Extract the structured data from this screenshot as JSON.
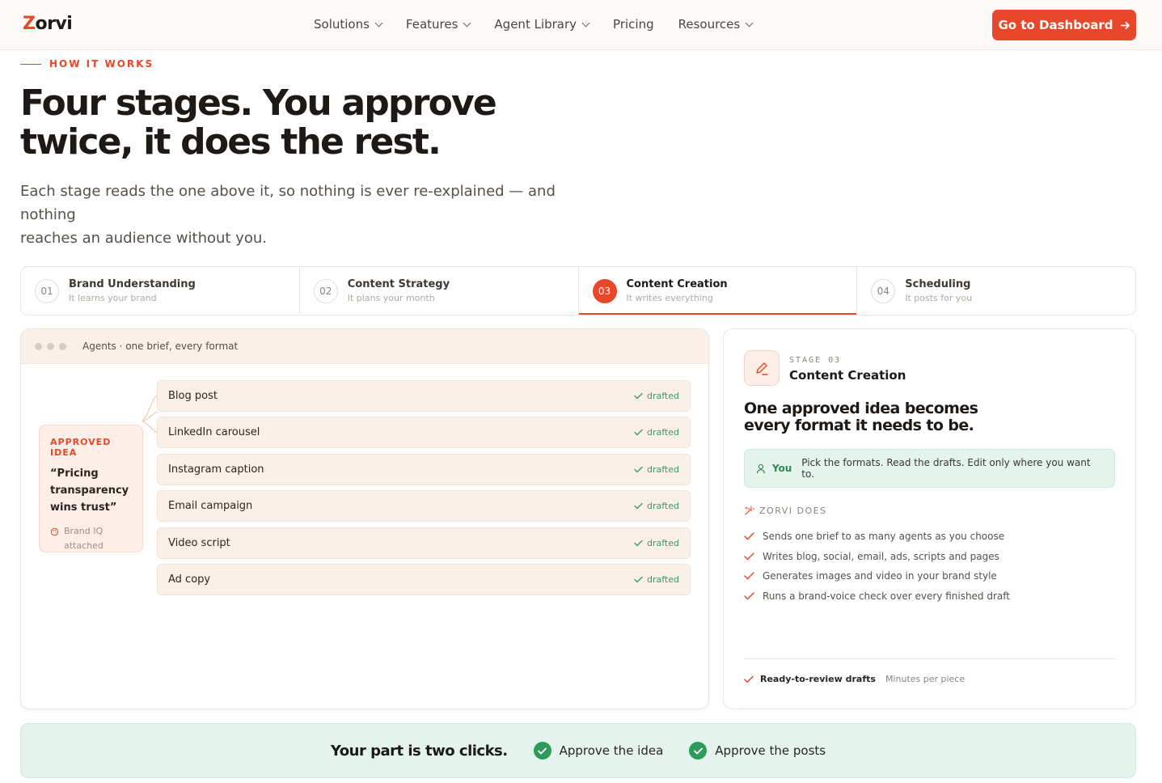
{
  "nav": {
    "logo_first": "Z",
    "logo_rest": "orvi",
    "items": [
      {
        "label": "Solutions",
        "has_dropdown": true
      },
      {
        "label": "Features",
        "has_dropdown": true
      },
      {
        "label": "Agent Library",
        "has_dropdown": true
      },
      {
        "label": "Pricing",
        "has_dropdown": false
      },
      {
        "label": "Resources",
        "has_dropdown": true
      }
    ],
    "cta_label": "Go to Dashboard"
  },
  "hero": {
    "eyebrow": "HOW IT WORKS",
    "title_line1": "Four stages. You approve",
    "title_line2": "twice, it does the rest.",
    "subtitle_line1": "Each stage reads the one above it, so nothing is ever re-explained — and nothing",
    "subtitle_line2": "reaches an audience without you."
  },
  "stages": [
    {
      "num": "01",
      "title": "Brand Understanding",
      "sub": "It learns your brand",
      "active": false
    },
    {
      "num": "02",
      "title": "Content Strategy",
      "sub": "It plans your month",
      "active": false
    },
    {
      "num": "03",
      "title": "Content Creation",
      "sub": "It writes everything",
      "active": true
    },
    {
      "num": "04",
      "title": "Scheduling",
      "sub": "It posts for you",
      "active": false
    }
  ],
  "agents_panel": {
    "header": "Agents · one brief, every format",
    "idea": {
      "caption": "APPROVED IDEA",
      "quote_l1": "“Pricing",
      "quote_l2": "transparency",
      "quote_l3": "wins trust”",
      "attach_l1": "Brand IQ",
      "attach_l2": "attached"
    },
    "formats": [
      {
        "name": "Blog post",
        "status": "drafted"
      },
      {
        "name": "LinkedIn carousel",
        "status": "drafted"
      },
      {
        "name": "Instagram caption",
        "status": "drafted"
      },
      {
        "name": "Email campaign",
        "status": "drafted"
      },
      {
        "name": "Video script",
        "status": "drafted"
      },
      {
        "name": "Ad copy",
        "status": "drafted"
      }
    ]
  },
  "detail_panel": {
    "stage_label": "STAGE 03",
    "stage_name": "Content Creation",
    "headline_l1": "One approved idea becomes",
    "headline_l2": "every format it needs to be.",
    "you_label": "You",
    "you_text": "Pick the formats. Read the drafts. Edit only where you want to.",
    "does_caption": "ZORVI DOES",
    "does_items": [
      "Sends one brief to as many agents as you choose",
      "Writes blog, social, email, ads, scripts and pages",
      "Generates images and video in your brand style",
      "Runs a brand-voice check over every finished draft"
    ],
    "footer_bold": "Ready-to-review drafts",
    "footer_muted": "Minutes per piece"
  },
  "bottom_bar": {
    "lead": "Your part is two clicks.",
    "steps": [
      "Approve the idea",
      "Approve the posts"
    ]
  },
  "colors": {
    "accent": "#e8472a",
    "success": "#2e9a5c",
    "mint_bg": "#e4f4ec",
    "peach_bg": "#fbf0e8"
  }
}
